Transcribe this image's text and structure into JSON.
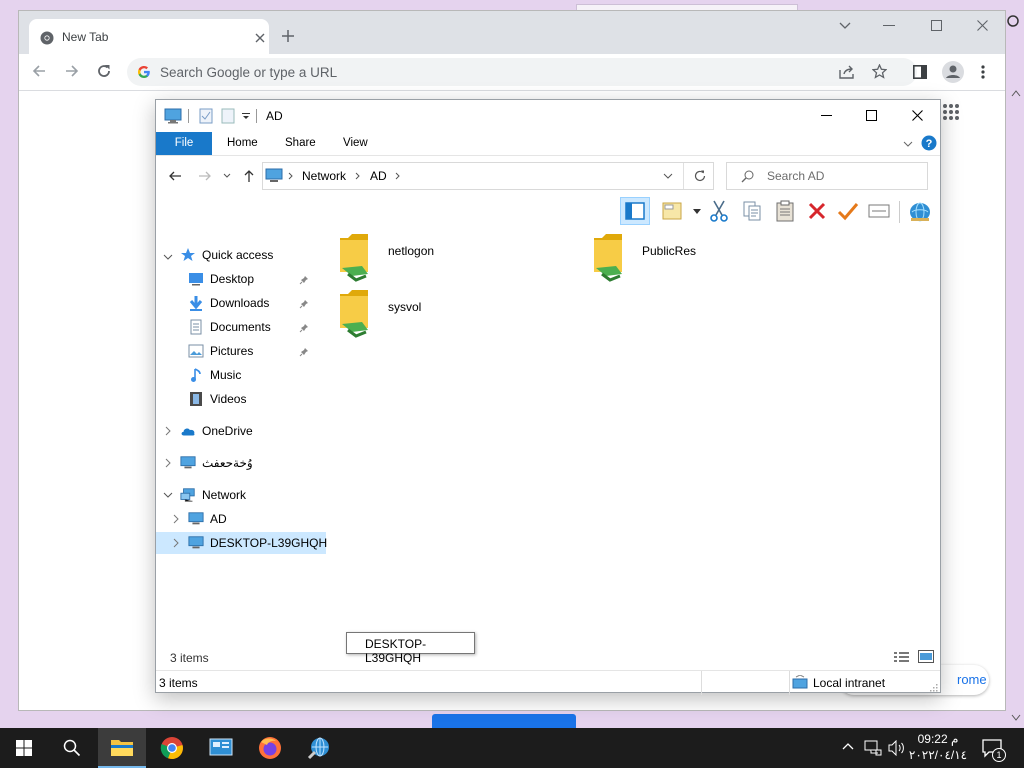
{
  "browser": {
    "tab_title": "New Tab",
    "omnibox_placeholder": "Search Google or type a URL",
    "customize_label": "rome"
  },
  "explorer": {
    "title": "AD",
    "ribbon_tabs": [
      "File",
      "Home",
      "Share",
      "View"
    ],
    "breadcrumb": [
      "Network",
      "AD"
    ],
    "search_placeholder": "Search AD",
    "tree": {
      "quick_access": "Quick access",
      "desktop": "Desktop",
      "downloads": "Downloads",
      "documents": "Documents",
      "pictures": "Pictures",
      "music": "Music",
      "videos": "Videos",
      "onedrive": "OneDrive",
      "this_pc": "ﻭُﺧﺔﺣﻌﻔﺚ",
      "network": "Network",
      "ad": "AD",
      "desktop_host": "DESKTOP-L39GHQH"
    },
    "files": [
      {
        "name": "netlogon"
      },
      {
        "name": "PublicRes"
      },
      {
        "name": "sysvol"
      }
    ],
    "status_items": "3 items",
    "status_items_bottom": "3 items",
    "zone": "Local intranet",
    "tooltip": "DESKTOP-L39GHQH"
  },
  "taskbar": {
    "time": "09:22 م",
    "date": "۲۰۲۲/۰٤/۱٤",
    "notification_count": "1"
  },
  "colors": {
    "accent": "#1979ca",
    "desktop_bg": "#e5d3ee",
    "taskbar": "#1c1c1c",
    "folder": "#f5c342",
    "share_green": "#4caf50"
  }
}
